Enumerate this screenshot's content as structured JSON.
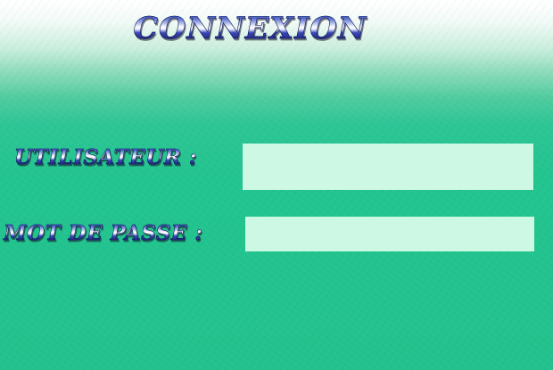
{
  "form": {
    "title": "CONNEXION",
    "username": {
      "label": "UTILISATEUR :",
      "value": "",
      "placeholder": ""
    },
    "password": {
      "label": "MOT DE PASSE :",
      "value": "",
      "placeholder": ""
    }
  },
  "colors": {
    "background_top": "#ffffff",
    "background_main": "#22c48f",
    "field_fill": "#ccf8e4",
    "text_dark": "#1b1f6e",
    "text_highlight": "#ffffff"
  }
}
